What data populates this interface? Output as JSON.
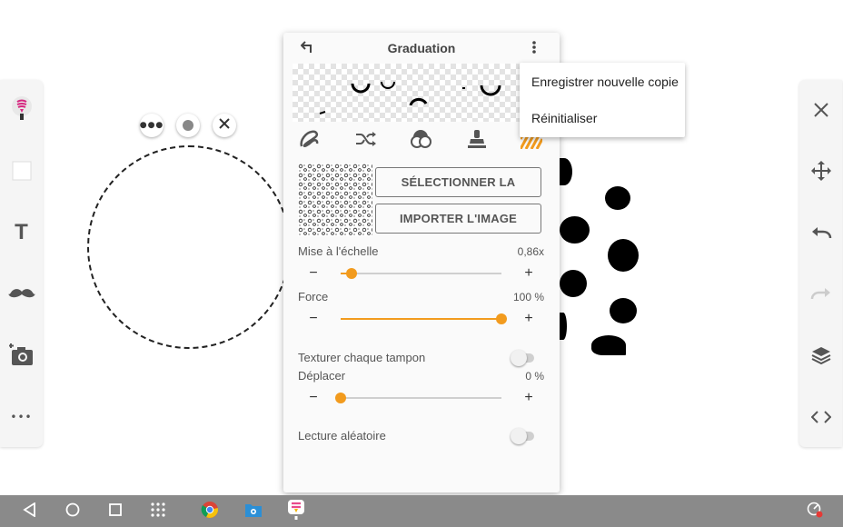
{
  "panel": {
    "title": "Graduation",
    "select_texture_label": "SÉLECTIONNER LA TEXTURE",
    "import_image_label": "IMPORTER L'IMAGE",
    "scale": {
      "label": "Mise à l'échelle",
      "value_text": "0,86x",
      "level": 0.07
    },
    "force": {
      "label": "Force",
      "value_text": "100 %",
      "level": 1.0
    },
    "texture_each_stamp": {
      "label": "Texturer chaque tampon",
      "on": false
    },
    "move": {
      "label": "Déplacer",
      "value_text": "0 %",
      "level": 0.0
    },
    "random_playback": {
      "label": "Lecture aléatoire",
      "on": false
    },
    "decrease_symbol": "−",
    "increase_symbol": "+",
    "mode_icons": [
      "brush-stroke-icon",
      "shuffle-icon",
      "shapes-icon",
      "stamp-icon",
      "texture-stripes-icon"
    ],
    "accent_color": "#f29b1e"
  },
  "menu": {
    "items": [
      {
        "label": "Enregistrer nouvelle copie"
      },
      {
        "label": "Réinitialiser"
      }
    ]
  },
  "left_toolbar": {
    "items": [
      "brush-tool-icon",
      "shape-square-icon",
      "text-tool-icon",
      "mustache-sticker-icon",
      "add-photo-icon",
      "more-icon"
    ],
    "text_tool_glyph": "T",
    "more_glyph": "•••"
  },
  "right_toolbar": {
    "items": [
      "close-icon",
      "move-icon",
      "undo-icon",
      "redo-icon",
      "layers-icon",
      "code-icon"
    ]
  },
  "canvas": {
    "selection_controls": [
      "more-options-button",
      "center-handle",
      "close-selection-button"
    ]
  },
  "system_nav": {
    "items": [
      "back-icon",
      "home-icon",
      "recents-icon",
      "app-grid-icon",
      "chrome-icon",
      "file-manager-icon",
      "drawing-app-icon",
      "status-icon"
    ]
  }
}
